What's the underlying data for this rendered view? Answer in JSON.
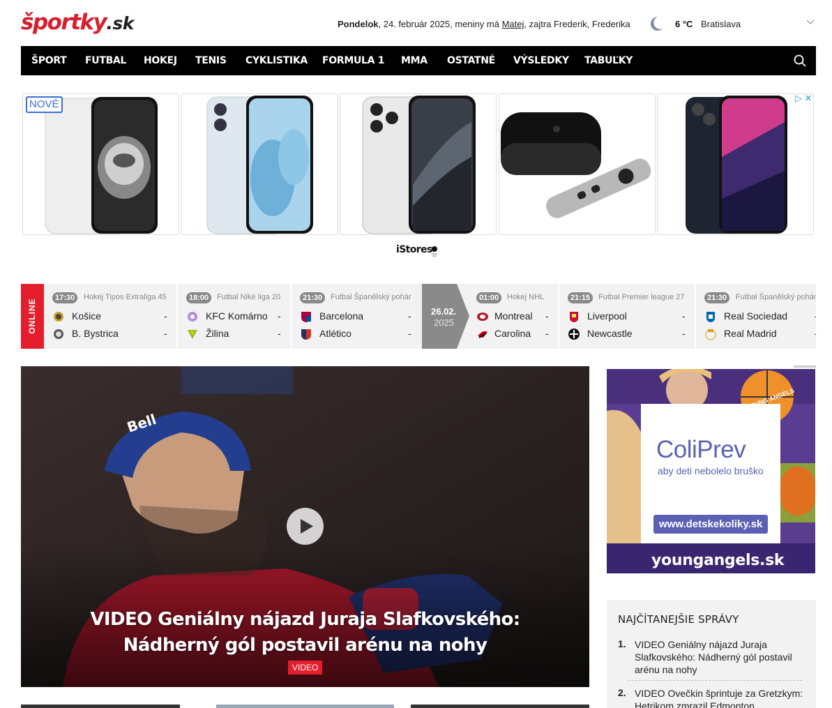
{
  "header": {
    "logo_main": "športky",
    "logo_tld": ".sk",
    "date_day": "Pondelok",
    "date_rest": ", 24. február 2025, meniny má ",
    "nameday": "Matej",
    "tomorrow": ", zajtra Frederik, Frederika",
    "temperature": "6 °C",
    "city": "Bratislava"
  },
  "nav": {
    "items": [
      "ŠPORT",
      "FUTBAL",
      "HOKEJ",
      "TENIS",
      "CYKLISTIKA",
      "FORMULA 1",
      "MMA",
      "OSTATNÉ",
      "VÝSLEDKY",
      "TABUĽKY"
    ]
  },
  "ad_banner": {
    "badge": "NOVÉ",
    "choice": "▷ ✕",
    "brand": "iStores"
  },
  "scores": {
    "online_label": "ONLINE",
    "date_sep": {
      "date": "26.02.",
      "year": "2025"
    },
    "matches": [
      {
        "time": "17:30",
        "league": "Hokej Tipos Extraliga 45",
        "home": "Košice",
        "away": "B. Bystrica",
        "home_score": "-",
        "away_score": "-"
      },
      {
        "time": "18:00",
        "league": "Futbal Niké liga 20",
        "home": "KFC Komárno",
        "away": "Žilina",
        "home_score": "-",
        "away_score": "-"
      },
      {
        "time": "21:30",
        "league": "Futbal Španělský pohár",
        "home": "Barcelona",
        "away": "Atlético",
        "home_score": "-",
        "away_score": "-"
      },
      {
        "time": "01:00",
        "league": "Hokej NHL",
        "home": "Montreal",
        "away": "Carolina",
        "home_score": "-",
        "away_score": "-"
      },
      {
        "time": "21:15",
        "league": "Futbal Premier league 27",
        "home": "Liverpool",
        "away": "Newcastle",
        "home_score": "-",
        "away_score": "-"
      },
      {
        "time": "21:30",
        "league": "Futbal Španělský pohár",
        "home": "Real Sociedad",
        "away": "Real Madrid",
        "home_score": "-",
        "away_score": "-"
      }
    ]
  },
  "hero": {
    "title": "VIDEO Geniálny nájazd Juraja Slafkovského: Nádherný gól postavil arénu na nohy",
    "tag": "VIDEO"
  },
  "side_ad": {
    "brand": "ColiPrev",
    "tagline": "aby deti nebolelo bruško",
    "url": "www.detskekoliky.sk",
    "footer": "youngangels.sk",
    "badge": "YOUNG ANGELS"
  },
  "most_read": {
    "title": "NAJČÍTANEJŠIE SPRÁVY",
    "items": [
      {
        "num": "1.",
        "text": "VIDEO Geniálny nájazd Juraja Slafkovského: Nádherný gól postavil arénu na nohy"
      },
      {
        "num": "2.",
        "text": "VIDEO Ovečkin šprintuje za Gretzkym: Hetrikom zmrazil Edmonton"
      }
    ]
  },
  "colors": {
    "brand_red": "#d81e2c",
    "nav_bg": "#000000",
    "scores_bg": "#f2f2f2"
  }
}
